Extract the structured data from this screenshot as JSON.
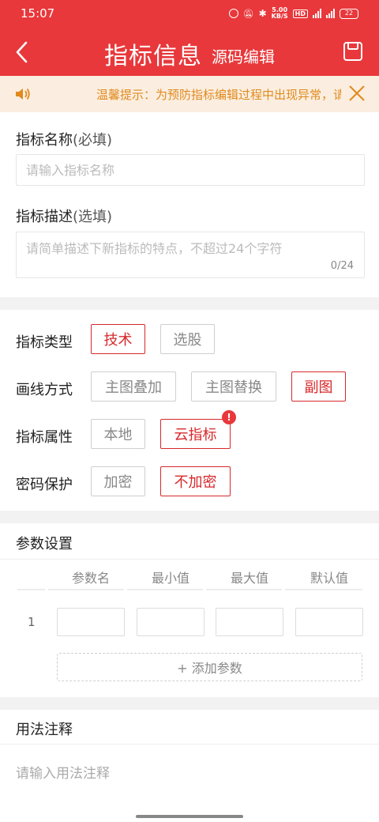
{
  "status_bar": {
    "time": "15:07",
    "net_speed_top": "5.00",
    "net_speed_bottom": "KB/S",
    "hd": "HD",
    "battery": "22"
  },
  "nav": {
    "title": "指标信息",
    "source_edit": "源码编辑",
    "back_icon": "chevron-left-icon",
    "save_icon": "save-icon"
  },
  "notice": {
    "text": "温馨提示：为预防指标编辑过程中出现异常，请及时保存",
    "close_icon": "close-icon"
  },
  "form": {
    "name_label": "指标名称",
    "name_hint": "(必填)",
    "name_placeholder": "请输入指标名称",
    "desc_label": "指标描述",
    "desc_hint": "(选填)",
    "desc_placeholder": "请简单描述下新指标的特点，不超过24个字符",
    "desc_counter": "0/24"
  },
  "options": {
    "type": {
      "label": "指标类型",
      "items": [
        "技术",
        "选股"
      ],
      "selected": "技术"
    },
    "draw": {
      "label": "画线方式",
      "items": [
        "主图叠加",
        "主图替换",
        "副图"
      ],
      "selected": "副图"
    },
    "attr": {
      "label": "指标属性",
      "items": [
        "本地",
        "云指标"
      ],
      "selected": "云指标",
      "badge": "!"
    },
    "password": {
      "label": "密码保护",
      "items": [
        "加密",
        "不加密"
      ],
      "selected": "不加密"
    }
  },
  "params": {
    "title": "参数设置",
    "headers": [
      "参数名",
      "最小值",
      "最大值",
      "默认值"
    ],
    "rows": [
      {
        "index": "1",
        "values": [
          "",
          "",
          "",
          ""
        ]
      }
    ],
    "add_label": "+ 添加参数"
  },
  "usage": {
    "title": "用法注释",
    "placeholder": "请输入用法注释"
  },
  "colors": {
    "brand": "#e8383b",
    "selected": "#d7282b",
    "notice_bg": "#fbeee0",
    "notice_text": "#e08a1e"
  }
}
